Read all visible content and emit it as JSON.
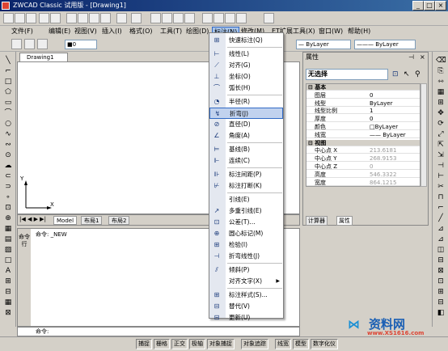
{
  "title": "ZWCAD Classic 试用版 - [Drawing1]",
  "menus": [
    "文件(F)",
    "编辑(E)",
    "视图(V)",
    "插入(I)",
    "格式(O)",
    "工具(T)",
    "绘图(D)",
    "标注(N)",
    "修改(M)",
    "ET扩展工具(X)",
    "窗口(W)",
    "帮助(H)"
  ],
  "layer_value": "0",
  "bylayer1": "ByLayer",
  "bylayer2": "ByLayer",
  "drawing_tab": "Drawing1",
  "ucs_y": "Y",
  "ucs_x": "X",
  "layout_tabs": [
    "Model",
    "布局1",
    "布局2"
  ],
  "command_lines": [
    "命令: _NEW",
    "命令:"
  ],
  "cmd_side": "命令行",
  "panel_title": "属性",
  "no_selection": "无选择",
  "props": [
    {
      "cat": true,
      "n": "基本",
      "v": ""
    },
    {
      "n": "图层",
      "v": "0"
    },
    {
      "n": "线型",
      "v": "ByLayer"
    },
    {
      "n": "线型比例",
      "v": "1"
    },
    {
      "n": "厚度",
      "v": "0"
    },
    {
      "n": "颜色",
      "v": "□ByLayer"
    },
    {
      "n": "线宽",
      "v": "—— ByLayer"
    },
    {
      "cat": true,
      "n": "视图",
      "v": ""
    },
    {
      "n": "中心点 X",
      "v": "213.6181",
      "gray": true
    },
    {
      "n": "中心点 Y",
      "v": "268.9153",
      "gray": true
    },
    {
      "n": "中心点 Z",
      "v": "0",
      "gray": true
    },
    {
      "n": "高度",
      "v": "546.3322",
      "gray": true
    },
    {
      "n": "宽度",
      "v": "864.1215",
      "gray": true
    }
  ],
  "panel_tabs": [
    "计算器",
    "属性"
  ],
  "menu_items": [
    {
      "label": "快速标注(Q)",
      "icon": "⊞"
    },
    {
      "sep": true
    },
    {
      "label": "线性(L)",
      "icon": "⊢"
    },
    {
      "label": "对齐(G)",
      "icon": "⟋"
    },
    {
      "label": "坐标(O)",
      "icon": "⊥"
    },
    {
      "label": "弧长(H)",
      "icon": "⌒"
    },
    {
      "sep": true
    },
    {
      "label": "半径(R)",
      "icon": "◔"
    },
    {
      "label": "折弯(J)",
      "icon": "↯",
      "hl": true
    },
    {
      "label": "直径(D)",
      "icon": "⊘"
    },
    {
      "label": "角度(A)",
      "icon": "∠"
    },
    {
      "sep": true
    },
    {
      "label": "基线(B)",
      "icon": "⊨"
    },
    {
      "label": "连续(C)",
      "icon": "⊩"
    },
    {
      "sep": true
    },
    {
      "label": "标注间距(P)",
      "icon": "⊪"
    },
    {
      "label": "标注打断(K)",
      "icon": "⊬"
    },
    {
      "sep": true
    },
    {
      "label": "引线(E)",
      "icon": ""
    },
    {
      "label": "多重引线(E)",
      "icon": "↗"
    },
    {
      "label": "公差(T)...",
      "icon": "⊡"
    },
    {
      "label": "圆心标记(M)",
      "icon": "⊕"
    },
    {
      "label": "检验(I)",
      "icon": "⊞"
    },
    {
      "label": "折弯线性(J)",
      "icon": "⊣"
    },
    {
      "sep": true
    },
    {
      "label": "倾斜(P)",
      "icon": "⫽"
    },
    {
      "label": "对齐文字(X)",
      "icon": "",
      "arrow": "▶"
    },
    {
      "sep": true
    },
    {
      "label": "标注样式(S)...",
      "icon": "⊞"
    },
    {
      "label": "替代(V)",
      "icon": "⊟"
    },
    {
      "label": "更新(U)",
      "icon": "⊟"
    }
  ],
  "status_items": [
    "捕捉",
    "栅格",
    "正交",
    "极轴",
    "对象捕捉",
    "对象追踪",
    "线宽",
    "模型",
    "数字化仪"
  ],
  "watermark": "资料网",
  "watermark_sub": "www.XS1616.com"
}
